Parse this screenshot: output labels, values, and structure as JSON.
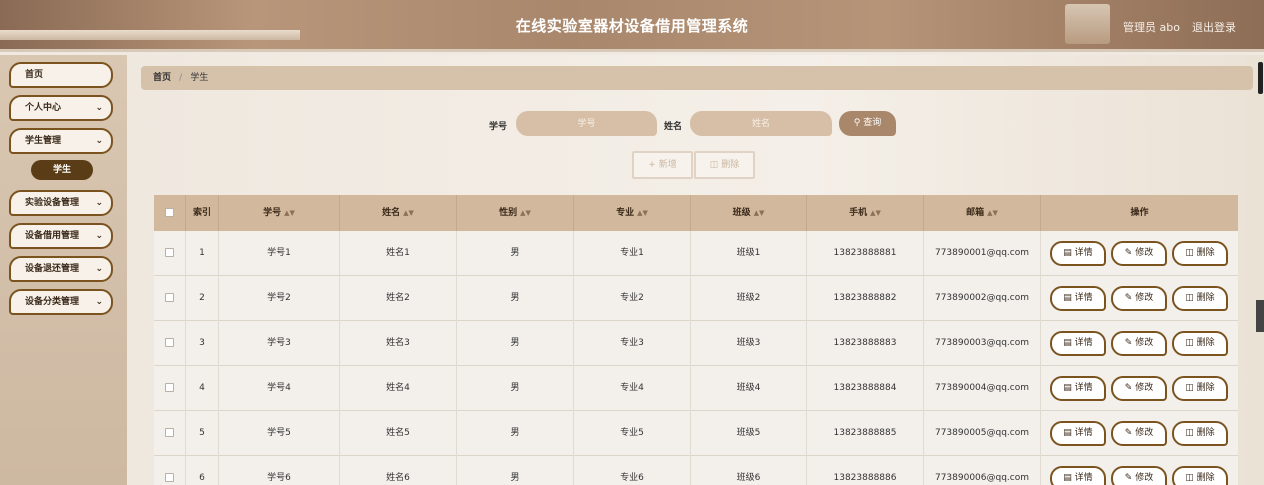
{
  "header": {
    "title": "在线实验室器材设备借用管理系统",
    "user": "管理员 abo",
    "logout": "退出登录"
  },
  "sidebar": {
    "items": [
      {
        "label": "首页",
        "has_arrow": false
      },
      {
        "label": "个人中心",
        "has_arrow": true
      },
      {
        "label": "学生管理",
        "has_arrow": true,
        "expanded": true
      },
      {
        "label": "实验设备管理",
        "has_arrow": true
      },
      {
        "label": "设备借用管理",
        "has_arrow": true
      },
      {
        "label": "设备退还管理",
        "has_arrow": true
      },
      {
        "label": "设备分类管理",
        "has_arrow": true
      }
    ],
    "sub_active": "学生",
    "chevron": "⌄"
  },
  "breadcrumb": {
    "home": "首页",
    "sep": "/",
    "current": "学生"
  },
  "search": {
    "student_id_label": "学号",
    "student_id_placeholder": "学号",
    "name_label": "姓名",
    "name_placeholder": "姓名",
    "query_label": "查询",
    "query_icon": "search-icon"
  },
  "actions": {
    "add_label": "新增",
    "delete_label": "删除"
  },
  "table": {
    "columns": [
      "",
      "索引",
      "学号",
      "姓名",
      "性别",
      "专业",
      "班级",
      "手机",
      "邮箱",
      "操作"
    ],
    "sortable": [
      false,
      false,
      true,
      true,
      true,
      true,
      true,
      true,
      true,
      false
    ],
    "rows": [
      {
        "index": "1",
        "id": "学号1",
        "name": "姓名1",
        "gender": "男",
        "major": "专业1",
        "class": "班级1",
        "phone": "13823888881",
        "email": "773890001@qq.com"
      },
      {
        "index": "2",
        "id": "学号2",
        "name": "姓名2",
        "gender": "男",
        "major": "专业2",
        "class": "班级2",
        "phone": "13823888882",
        "email": "773890002@qq.com"
      },
      {
        "index": "3",
        "id": "学号3",
        "name": "姓名3",
        "gender": "男",
        "major": "专业3",
        "class": "班级3",
        "phone": "13823888883",
        "email": "773890003@qq.com"
      },
      {
        "index": "4",
        "id": "学号4",
        "name": "姓名4",
        "gender": "男",
        "major": "专业4",
        "class": "班级4",
        "phone": "13823888884",
        "email": "773890004@qq.com"
      },
      {
        "index": "5",
        "id": "学号5",
        "name": "姓名5",
        "gender": "男",
        "major": "专业5",
        "class": "班级5",
        "phone": "13823888885",
        "email": "773890005@qq.com"
      },
      {
        "index": "6",
        "id": "学号6",
        "name": "姓名6",
        "gender": "男",
        "major": "专业6",
        "class": "班级6",
        "phone": "13823888886",
        "email": "773890006@qq.com"
      }
    ],
    "row_actions": {
      "detail": "详情",
      "edit": "修改",
      "delete": "删除"
    }
  },
  "colors": {
    "accent": "#7a531f",
    "header_bg": "#d2b89d",
    "active": "#5a3d16"
  }
}
